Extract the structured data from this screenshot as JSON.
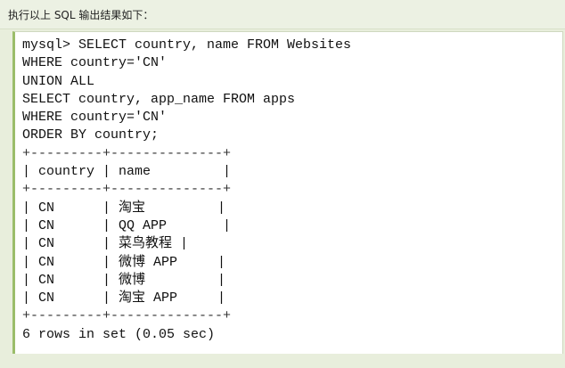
{
  "caption": "执行以上 SQL 输出结果如下：",
  "code": {
    "lines": [
      "mysql> SELECT country, name FROM Websites",
      "WHERE country='CN'",
      "UNION ALL",
      "SELECT country, app_name FROM apps",
      "WHERE country='CN'",
      "ORDER BY country;",
      "+---------+--------------+",
      "| country | name         |",
      "+---------+--------------+",
      "| CN      | 淘宝         |",
      "| CN      | QQ APP       |",
      "| CN      | 菜鸟教程 |",
      "| CN      | 微博 APP     |",
      "| CN      | 微博         |",
      "| CN      | 淘宝 APP     |",
      "+---------+--------------+",
      "6 rows in set (0.05 sec)"
    ]
  }
}
